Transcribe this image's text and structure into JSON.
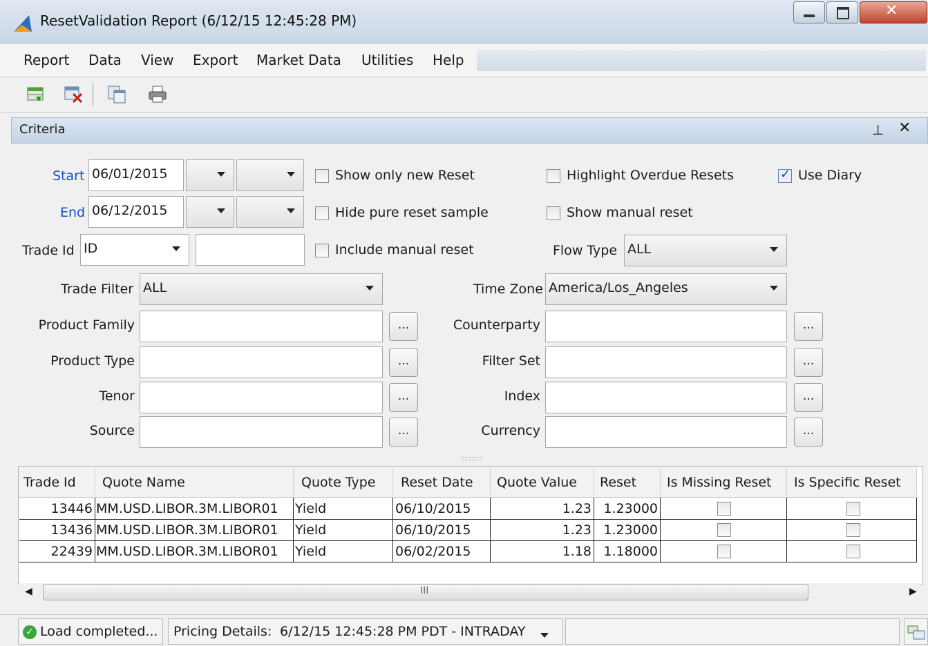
{
  "window": {
    "title": "ResetValidation Report (6/12/15 12:45:28 PM)"
  },
  "menu": {
    "items": [
      "Report",
      "Data",
      "View",
      "Export",
      "Market Data",
      "Utilities",
      "Help"
    ]
  },
  "toolbar": {
    "icons": [
      "load-report-icon",
      "clear-report-icon",
      "report-template-icon",
      "print-icon"
    ]
  },
  "criteria": {
    "title": "Criteria",
    "start_label": "Start",
    "start_value": "06/01/2015",
    "end_label": "End",
    "end_value": "06/12/2015",
    "trade_id_label": "Trade Id",
    "trade_id_type": "ID",
    "trade_id_value": "",
    "trade_filter_label": "Trade Filter",
    "trade_filter_value": "ALL",
    "flow_type_label": "Flow Type",
    "flow_type_value": "ALL",
    "time_zone_label": "Time Zone",
    "time_zone_value": "America/Los_Angeles",
    "dots_label": "...",
    "left_fields": [
      "Product Family",
      "Product Type",
      "Tenor",
      "Source"
    ],
    "right_fields": [
      "Counterparty",
      "Filter Set",
      "Index",
      "Currency"
    ],
    "checkboxes": {
      "show_only_new_reset": {
        "label": "Show only new Reset",
        "checked": false
      },
      "hide_pure_reset_sample": {
        "label": "Hide pure reset sample",
        "checked": false
      },
      "include_manual_reset": {
        "label": "Include manual reset",
        "checked": false
      },
      "highlight_overdue_resets": {
        "label": "Highlight Overdue Resets",
        "checked": false
      },
      "show_manual_reset": {
        "label": "Show manual reset",
        "checked": false
      },
      "use_diary": {
        "label": "Use Diary",
        "checked": true
      }
    }
  },
  "table": {
    "columns": [
      "Trade Id",
      "Quote Name",
      "Quote Type",
      "Reset Date",
      "Quote Value",
      "Reset",
      "Is Missing Reset",
      "Is Specific Reset"
    ],
    "rows": [
      {
        "trade_id": "13446",
        "quote_name": "MM.USD.LIBOR.3M.LIBOR01",
        "quote_type": "Yield",
        "reset_date": "06/10/2015",
        "quote_value": "1.23",
        "reset": "1.23000",
        "is_missing_reset": false,
        "is_specific_reset": false
      },
      {
        "trade_id": "13436",
        "quote_name": "MM.USD.LIBOR.3M.LIBOR01",
        "quote_type": "Yield",
        "reset_date": "06/10/2015",
        "quote_value": "1.23",
        "reset": "1.23000",
        "is_missing_reset": false,
        "is_specific_reset": false
      },
      {
        "trade_id": "22439",
        "quote_name": "MM.USD.LIBOR.3M.LIBOR01",
        "quote_type": "Yield",
        "reset_date": "06/02/2015",
        "quote_value": "1.18",
        "reset": "1.18000",
        "is_missing_reset": false,
        "is_specific_reset": false
      }
    ]
  },
  "scrollbar": {
    "grip": "III"
  },
  "status": {
    "load_text": "Load completed...",
    "pricing_label": "Pricing Details:",
    "pricing_value": "6/12/15 12:45:28 PM PDT - INTRADAY"
  }
}
